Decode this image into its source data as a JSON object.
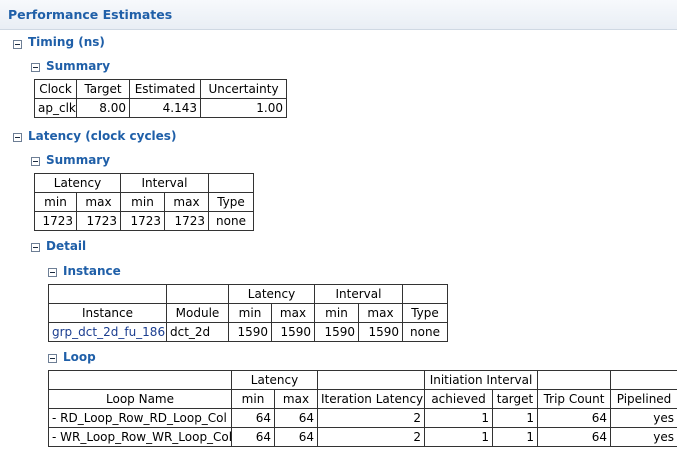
{
  "page_title": "Performance Estimates",
  "timing": {
    "title": "Timing (ns)",
    "summary": {
      "title": "Summary",
      "headers": [
        "Clock",
        "Target",
        "Estimated",
        "Uncertainty"
      ],
      "row": [
        "ap_clk",
        "8.00",
        "4.143",
        "1.00"
      ]
    }
  },
  "latency": {
    "title": "Latency (clock cycles)",
    "summary": {
      "title": "Summary",
      "group_headers": [
        "Latency",
        "Interval"
      ],
      "headers": [
        "min",
        "max",
        "min",
        "max",
        "Type"
      ],
      "row": [
        "1723",
        "1723",
        "1723",
        "1723",
        "none"
      ]
    },
    "detail": {
      "title": "Detail",
      "instance": {
        "title": "Instance",
        "group_headers": [
          "Latency",
          "Interval"
        ],
        "headers": [
          "Instance",
          "Module",
          "min",
          "max",
          "min",
          "max",
          "Type"
        ],
        "row": [
          "grp_dct_2d_fu_186",
          "dct_2d",
          "1590",
          "1590",
          "1590",
          "1590",
          "none"
        ]
      },
      "loop": {
        "title": "Loop",
        "group_headers": [
          "Latency",
          "Initiation Interval"
        ],
        "headers": [
          "Loop Name",
          "min",
          "max",
          "Iteration Latency",
          "achieved",
          "target",
          "Trip Count",
          "Pipelined"
        ],
        "rows": [
          [
            "- RD_Loop_Row_RD_Loop_Col",
            "64",
            "64",
            "2",
            "1",
            "1",
            "64",
            "yes"
          ],
          [
            "- WR_Loop_Row_WR_Loop_Col",
            "64",
            "64",
            "2",
            "1",
            "1",
            "64",
            "yes"
          ]
        ]
      }
    }
  }
}
